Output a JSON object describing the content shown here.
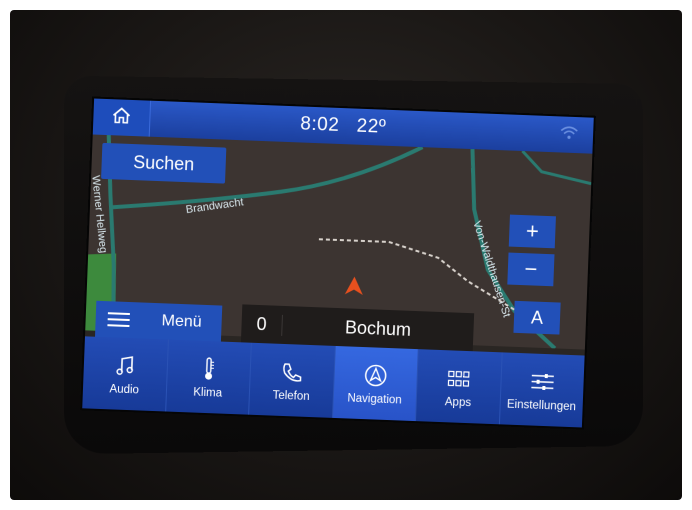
{
  "status_bar": {
    "time": "8:02",
    "temperature": "22º",
    "home_icon": "home-icon",
    "wifi_icon": "wifi-icon"
  },
  "map": {
    "search_label": "Suchen",
    "streets": [
      "Brandwacht",
      "Werner Hellweg",
      "Von-Waldthausen-St"
    ],
    "zoom_in": "+",
    "zoom_out": "−",
    "orientation": "A"
  },
  "menu": {
    "label": "Menü"
  },
  "destination": {
    "distance": "0",
    "city": "Bochum"
  },
  "tabs": [
    {
      "label": "Audio",
      "icon": "music-note-icon"
    },
    {
      "label": "Klima",
      "icon": "thermometer-icon"
    },
    {
      "label": "Telefon",
      "icon": "phone-icon"
    },
    {
      "label": "Navigation",
      "icon": "navigation-icon"
    },
    {
      "label": "Apps",
      "icon": "apps-grid-icon"
    },
    {
      "label": "Einstellungen",
      "icon": "settings-sliders-icon"
    }
  ],
  "colors": {
    "accent": "#2250b8",
    "active_tab": "#2f5fd8",
    "map_background": "#3c3431",
    "road_teal": "#2a7a70",
    "park_green": "#3d8a3d",
    "position_marker": "#e8501e"
  }
}
